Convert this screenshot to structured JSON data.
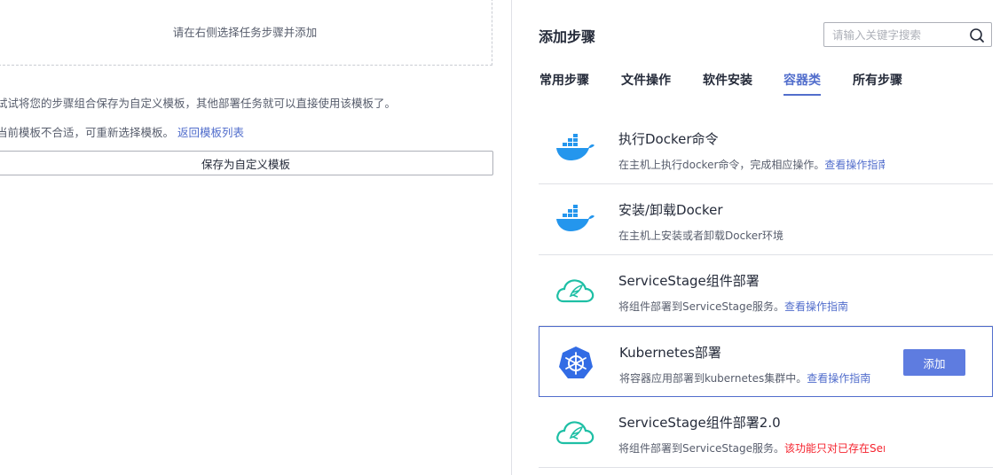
{
  "left": {
    "dropzone_text": "请在右侧选择任务步骤并添加",
    "tip_line1": "试试将您的步骤组合保存为自定义模板，其他部署任务就可以直接使用该模板了。",
    "tip_line2_prefix": "当前模板不合适，可重新选择模板。",
    "tip_line2_link": "返回模板列表",
    "save_button_label": "保存为自定义模板"
  },
  "right": {
    "title": "添加步骤",
    "search": {
      "placeholder": "请输入关键字搜索",
      "value": ""
    },
    "tabs": [
      "常用步骤",
      "文件操作",
      "软件安装",
      "容器类",
      "所有步骤"
    ],
    "active_tab": "容器类",
    "steps": [
      {
        "name": "执行Docker命令",
        "desc": "在主机上执行docker命令，完成相应操作。",
        "link": "查看操作指南",
        "icon": "docker-icon"
      },
      {
        "name": "安装/卸载Docker",
        "desc": "在主机上安装或者卸载Docker环境",
        "link": "",
        "icon": "docker-icon"
      },
      {
        "name": "ServiceStage组件部署",
        "desc": "将组件部署到ServiceStage服务。",
        "link": "查看操作指南",
        "icon": "servicestage-cloud-icon"
      },
      {
        "name": "Kubernetes部署",
        "desc": "将容器应用部署到kubernetes集群中。",
        "link": "查看操作指南",
        "icon": "kubernetes-icon",
        "selected": true,
        "add_label": "添加"
      },
      {
        "name": "ServiceStage组件部署2.0",
        "desc": "将组件部署到ServiceStage服务。",
        "warning": "该功能只对已存在Servic",
        "icon": "servicestage-cloud-icon"
      }
    ]
  },
  "colors": {
    "accent": "#526ecc",
    "primary_button": "#5e7ce0",
    "warning": "#f5222d",
    "docker": "#2496ed",
    "servicestage": "#1ebfa5",
    "kubernetes": "#326ce5"
  }
}
